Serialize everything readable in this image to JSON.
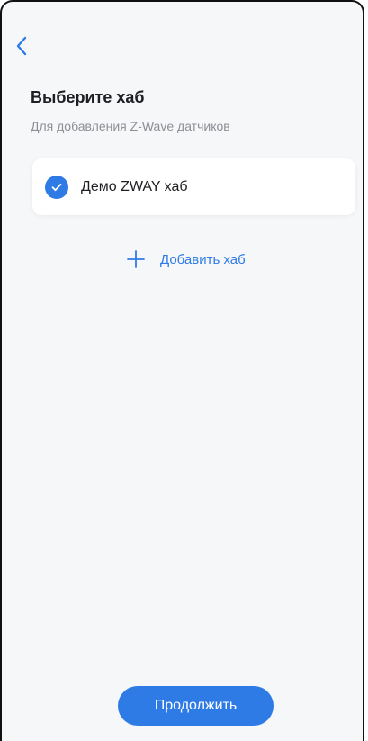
{
  "header": {
    "title": "Выберите хаб",
    "subtitle": "Для добавления Z-Wave датчиков"
  },
  "icons": {
    "back": "chevron-left-icon",
    "selected": "check-circle-icon",
    "add": "plus-icon"
  },
  "hubs": [
    {
      "name": "Демо ZWAY хаб",
      "selected": true
    }
  ],
  "actions": {
    "add_hub_label": "Добавить хаб",
    "continue_label": "Продолжить"
  },
  "colors": {
    "accent": "#2f7be5",
    "background": "#f6f7f9",
    "card": "#ffffff",
    "title_text": "#1f1f23",
    "secondary_text": "#8d8f95"
  }
}
